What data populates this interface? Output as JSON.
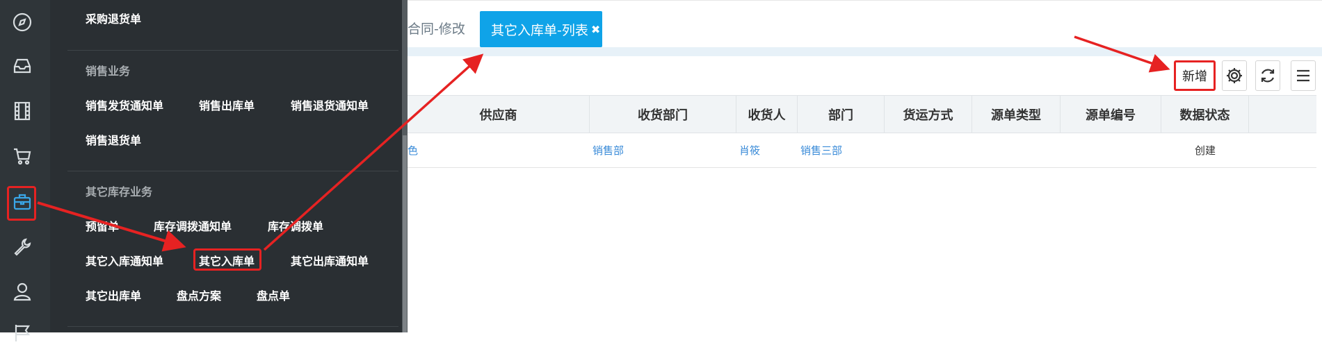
{
  "rail": {
    "icons": [
      "compass-icon",
      "inbox-icon",
      "film-icon",
      "cart-icon",
      "briefcase-icon",
      "wrench-icon",
      "user-icon",
      "flag-icon"
    ],
    "active_icon": "briefcase-icon"
  },
  "flyout": {
    "top_item": "采购退货单",
    "sales": {
      "title": "销售业务",
      "items": [
        "销售发货通知单",
        "销售出库单",
        "销售退货通知单",
        "销售退货单"
      ]
    },
    "other": {
      "title": "其它库存业务",
      "items": [
        "预留单",
        "库存调拨通知单",
        "库存调拨单",
        "其它入库通知单",
        "其它入库单",
        "其它出库通知单",
        "其它出库单",
        "盘点方案",
        "盘点单"
      ]
    }
  },
  "tabs": {
    "previous": "合同-修改",
    "active": "其它入库单-列表",
    "close_symbol": "✖"
  },
  "toolbar": {
    "add_label": "新增",
    "settings_icon": "gear-icon",
    "refresh_icon": "refresh-icon",
    "menu_icon": "menu-icon"
  },
  "grid": {
    "columns": [
      "供应商",
      "收货部门",
      "收货人",
      "部门",
      "货运方式",
      "源单类型",
      "源单编号",
      "数据状态"
    ],
    "rows": [
      {
        "supplier_fragment": "色",
        "receive_dept": "销售部",
        "receiver": "肖筱",
        "dept": "销售三部",
        "shipping": "",
        "source_type": "",
        "source_no": "",
        "status": "创建"
      }
    ]
  },
  "colors": {
    "accent": "#0fa3e8",
    "annotation": "#e62222",
    "sidebar_bg": "#2f3539",
    "flyout_bg": "#2a2f33",
    "link": "#3a8bd8"
  }
}
